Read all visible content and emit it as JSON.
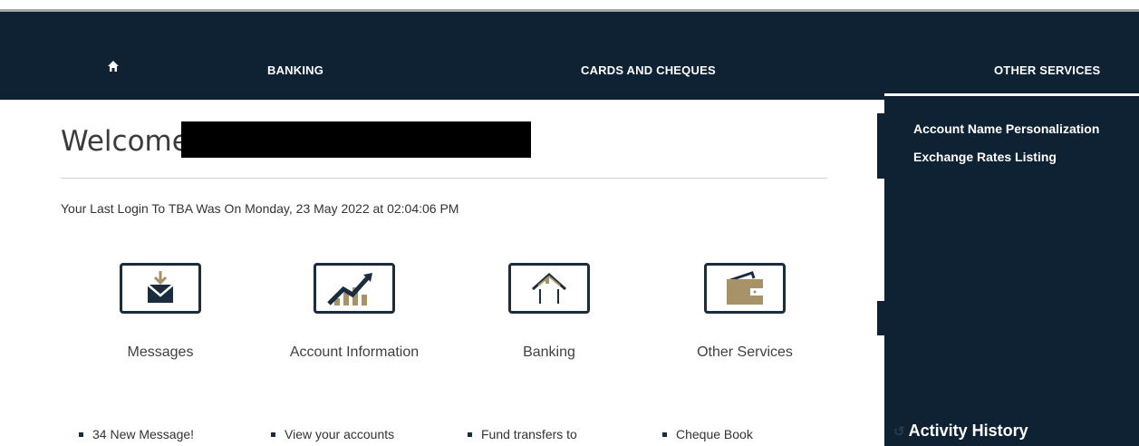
{
  "nav": {
    "home_icon": "home-icon",
    "banking": "BANKING",
    "cards": "CARDS AND CHEQUES",
    "other": "OTHER SERVICES"
  },
  "main": {
    "welcome": "Welcome",
    "last_login": "Your Last Login To TBA Was On Monday, 23 May 2022 at 02:04:06 PM",
    "tiles": [
      {
        "label": "Messages",
        "icon": "messages-icon",
        "bullet": "34 New Message!"
      },
      {
        "label": "Account Information",
        "icon": "account-information-icon",
        "bullet": "View your accounts"
      },
      {
        "label": "Banking",
        "icon": "banking-icon",
        "bullet": "Fund transfers to"
      },
      {
        "label": "Other Services",
        "icon": "other-services-icon",
        "bullet": "Cheque Book"
      }
    ]
  },
  "sidebar": {
    "links": [
      "Account Name Personalization",
      "Exchange Rates Listing"
    ],
    "activity": "Activity History"
  },
  "colors": {
    "navy": "#0e2233",
    "gold": "#a89268"
  }
}
